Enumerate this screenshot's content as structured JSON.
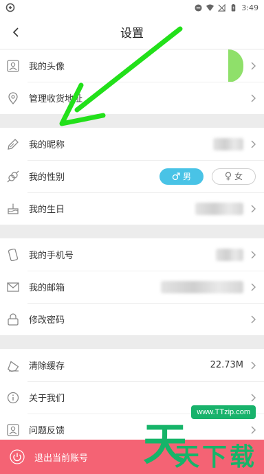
{
  "status_bar": {
    "time": "3:49"
  },
  "header": {
    "title": "设置"
  },
  "sections": [
    {
      "rows": [
        {
          "label": "我的头像"
        },
        {
          "label": "管理收货地址"
        }
      ]
    },
    {
      "rows": [
        {
          "label": "我的昵称"
        },
        {
          "label": "我的性别",
          "options": [
            {
              "label": "男"
            },
            {
              "label": "女"
            }
          ],
          "selected": "男"
        },
        {
          "label": "我的生日"
        }
      ]
    },
    {
      "rows": [
        {
          "label": "我的手机号"
        },
        {
          "label": "我的邮箱"
        },
        {
          "label": "修改密码"
        }
      ]
    },
    {
      "rows": [
        {
          "label": "清除缓存",
          "value": "22.73M"
        },
        {
          "label": "关于我们"
        },
        {
          "label": "问题反馈"
        }
      ]
    }
  ],
  "logout": {
    "label": "退出当前账号"
  },
  "watermark": {
    "site": "www.TTzip.com",
    "text": "天下载",
    "big": "天"
  },
  "colors": {
    "accent_blue": "#49c3e6",
    "logout_red": "#f46374",
    "arrow_green": "#22e01a",
    "watermark_green": "#16b469"
  }
}
